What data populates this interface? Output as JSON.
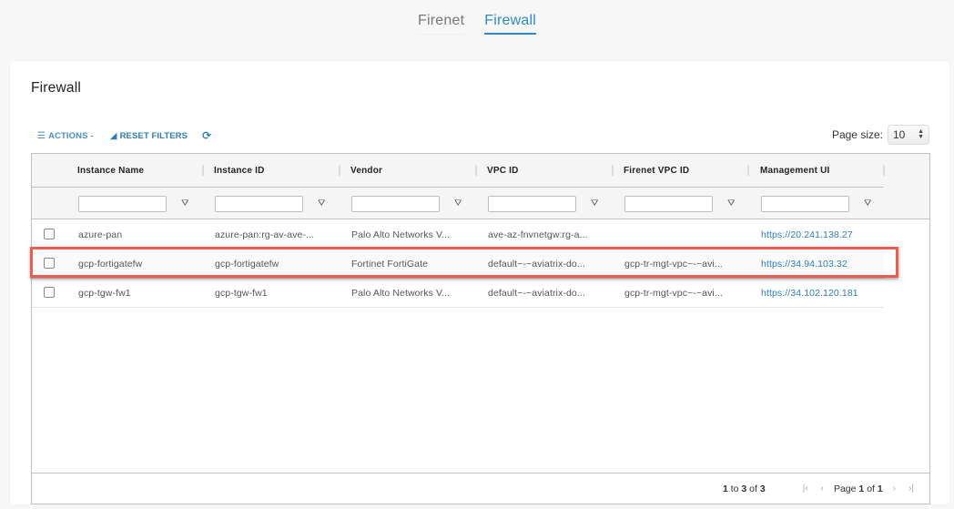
{
  "top_tabs": [
    {
      "label": "Firenet",
      "active": false
    },
    {
      "label": "Firewall",
      "active": true
    }
  ],
  "card": {
    "title": "Firewall"
  },
  "toolbar": {
    "actions_label": "ACTIONS",
    "actions_caret": "-",
    "reset_filters_label": "RESET FILTERS",
    "list_icon": "list-icon",
    "eraser_icon": "eraser-icon",
    "refresh_icon": "refresh-icon"
  },
  "page_size": {
    "label": "Page size:",
    "value": "10"
  },
  "table": {
    "columns": [
      "Instance Name",
      "Instance ID",
      "Vendor",
      "VPC ID",
      "Firenet VPC ID",
      "Management UI"
    ],
    "filter_placeholders": [
      "",
      "",
      "",
      "",
      "",
      ""
    ],
    "rows": [
      {
        "instance_name": "azure-pan",
        "instance_id": "azure-pan:rg-av-ave-...",
        "vendor": "Palo Alto Networks V...",
        "vpc_id": "ave-az-fnvnetgw:rg-a...",
        "firenet_vpc_id": "",
        "management_ui": "https://20.241.138.27",
        "highlighted": false
      },
      {
        "instance_name": "gcp-fortigatefw",
        "instance_id": "gcp-fortigatefw",
        "vendor": "Fortinet FortiGate",
        "vpc_id": "default~-~aviatrix-do...",
        "firenet_vpc_id": "gcp-tr-mgt-vpc~-~avi...",
        "management_ui": "https://34.94.103.32",
        "highlighted": true
      },
      {
        "instance_name": "gcp-tgw-fw1",
        "instance_id": "gcp-tgw-fw1",
        "vendor": "Palo Alto Networks V...",
        "vpc_id": "default~-~aviatrix-do...",
        "firenet_vpc_id": "gcp-tr-mgt-vpc~-~avi...",
        "management_ui": "https://34.102.120.181",
        "highlighted": false
      }
    ]
  },
  "footer": {
    "from": "1",
    "to_label": "to",
    "to": "3",
    "of_label": "of",
    "total": "3",
    "page_label": "Page",
    "page": "1",
    "page_of_label": "of",
    "page_total": "1"
  },
  "colors": {
    "accent": "#2d8ac6",
    "link": "#2d7fb8",
    "highlight_border": "#f05a4f"
  }
}
